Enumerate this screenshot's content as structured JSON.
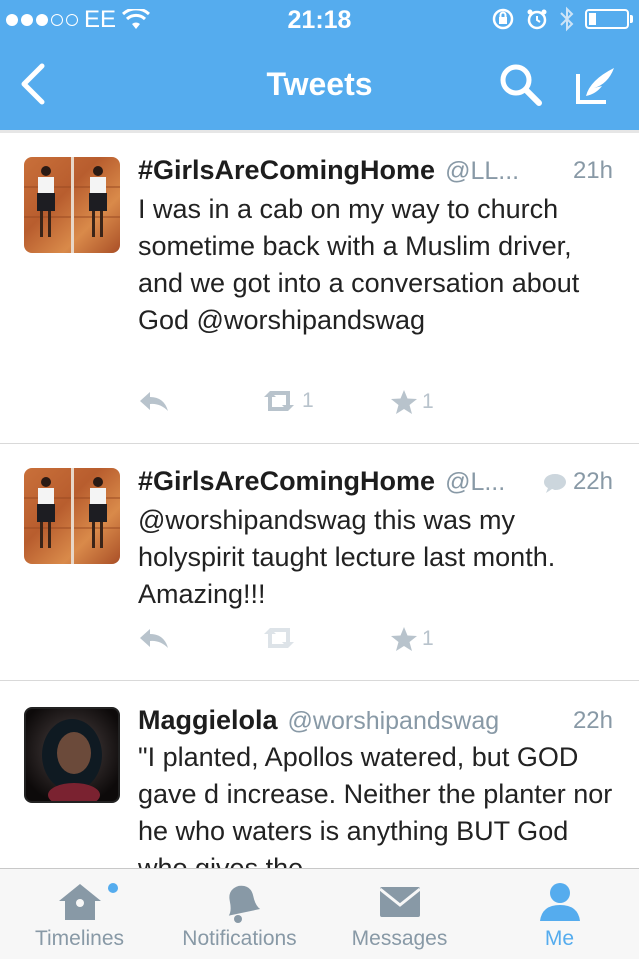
{
  "status_bar": {
    "carrier": "EE",
    "time": "21:18"
  },
  "nav": {
    "title": "Tweets"
  },
  "tweets": [
    {
      "name": "#GirlsAreComingHome",
      "handle": "@LL...",
      "time": "21h",
      "text": "I was in a cab on my way to church sometime back with a Muslim driver, and we got into a conversation about God @worshipandswag",
      "retweets": "1",
      "favorites": "1"
    },
    {
      "name": "#GirlsAreComingHome",
      "handle": "@L...",
      "time": "22h",
      "text": "@worshipandswag this was my holyspirit taught lecture last month. Amazing!!!",
      "retweets": "",
      "favorites": "1"
    },
    {
      "name": "Maggielola",
      "handle": "@worshipandswag",
      "time": "22h",
      "text": "\"I planted, Apollos watered, but GOD gave d increase. Neither the planter nor he who waters is anything BUT God who gives the"
    }
  ],
  "tabs": [
    {
      "label": "Timelines"
    },
    {
      "label": "Notifications"
    },
    {
      "label": "Messages"
    },
    {
      "label": "Me"
    }
  ],
  "colors": {
    "brand": "#55acee",
    "muted": "#8899a6",
    "action": "#b8c3cc"
  }
}
